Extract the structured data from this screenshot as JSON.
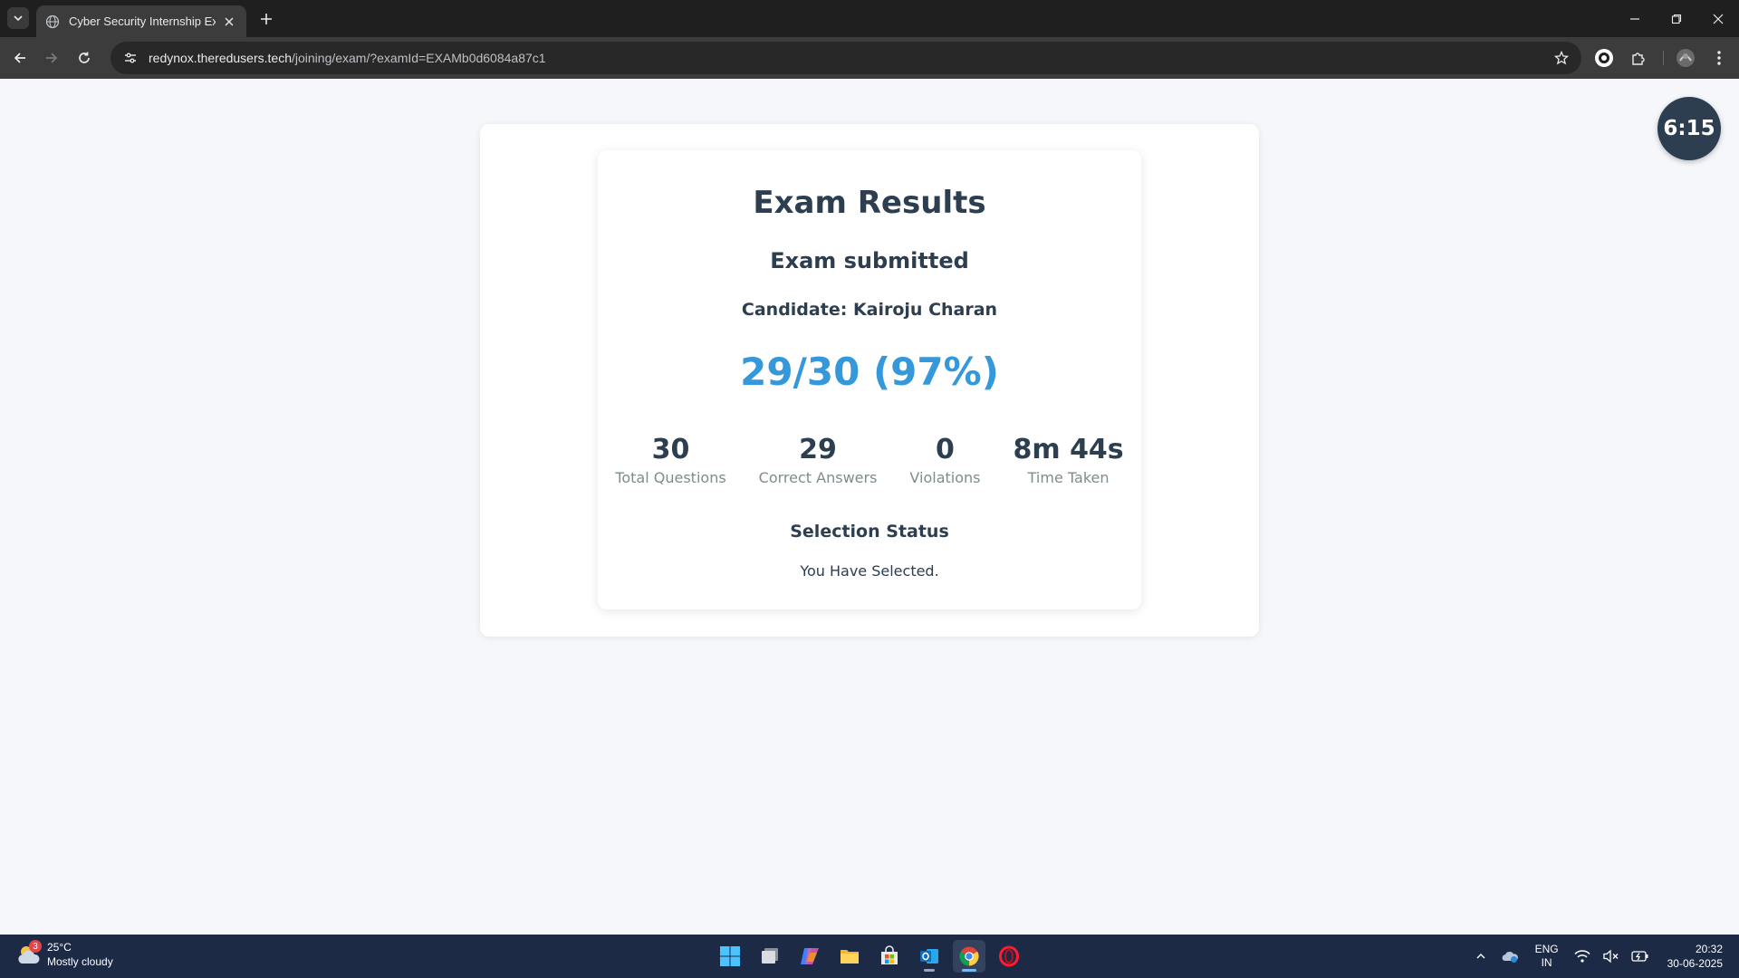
{
  "browser": {
    "tab_title": "Cyber Security Internship Exam",
    "url_host": "redynox.theredusers.tech",
    "url_path": "/joining/exam/?examId=EXAMb0d6084a87c1"
  },
  "exam": {
    "title": "Exam Results",
    "status": "Exam submitted",
    "candidate_label": "Candidate:",
    "candidate_name": "Kairoju Charan",
    "score": "29/30 (97%)",
    "stats": [
      {
        "value": "30",
        "label": "Total Questions"
      },
      {
        "value": "29",
        "label": "Correct Answers"
      },
      {
        "value": "0",
        "label": "Violations"
      },
      {
        "value": "8m 44s",
        "label": "Time Taken"
      }
    ],
    "selection_heading": "Selection Status",
    "selection_text": "You Have Selected."
  },
  "timer": "6:15",
  "taskbar": {
    "weather_badge": "3",
    "temperature": "25°C",
    "condition": "Mostly cloudy",
    "lang_line1": "ENG",
    "lang_line2": "IN",
    "time": "20:32",
    "date": "30-06-2025"
  },
  "colors": {
    "accent": "#3498db",
    "text": "#2c3e50",
    "muted": "#7f8c8d",
    "page_bg": "#f5f7fa",
    "taskbar_bg": "#1c2a45"
  }
}
